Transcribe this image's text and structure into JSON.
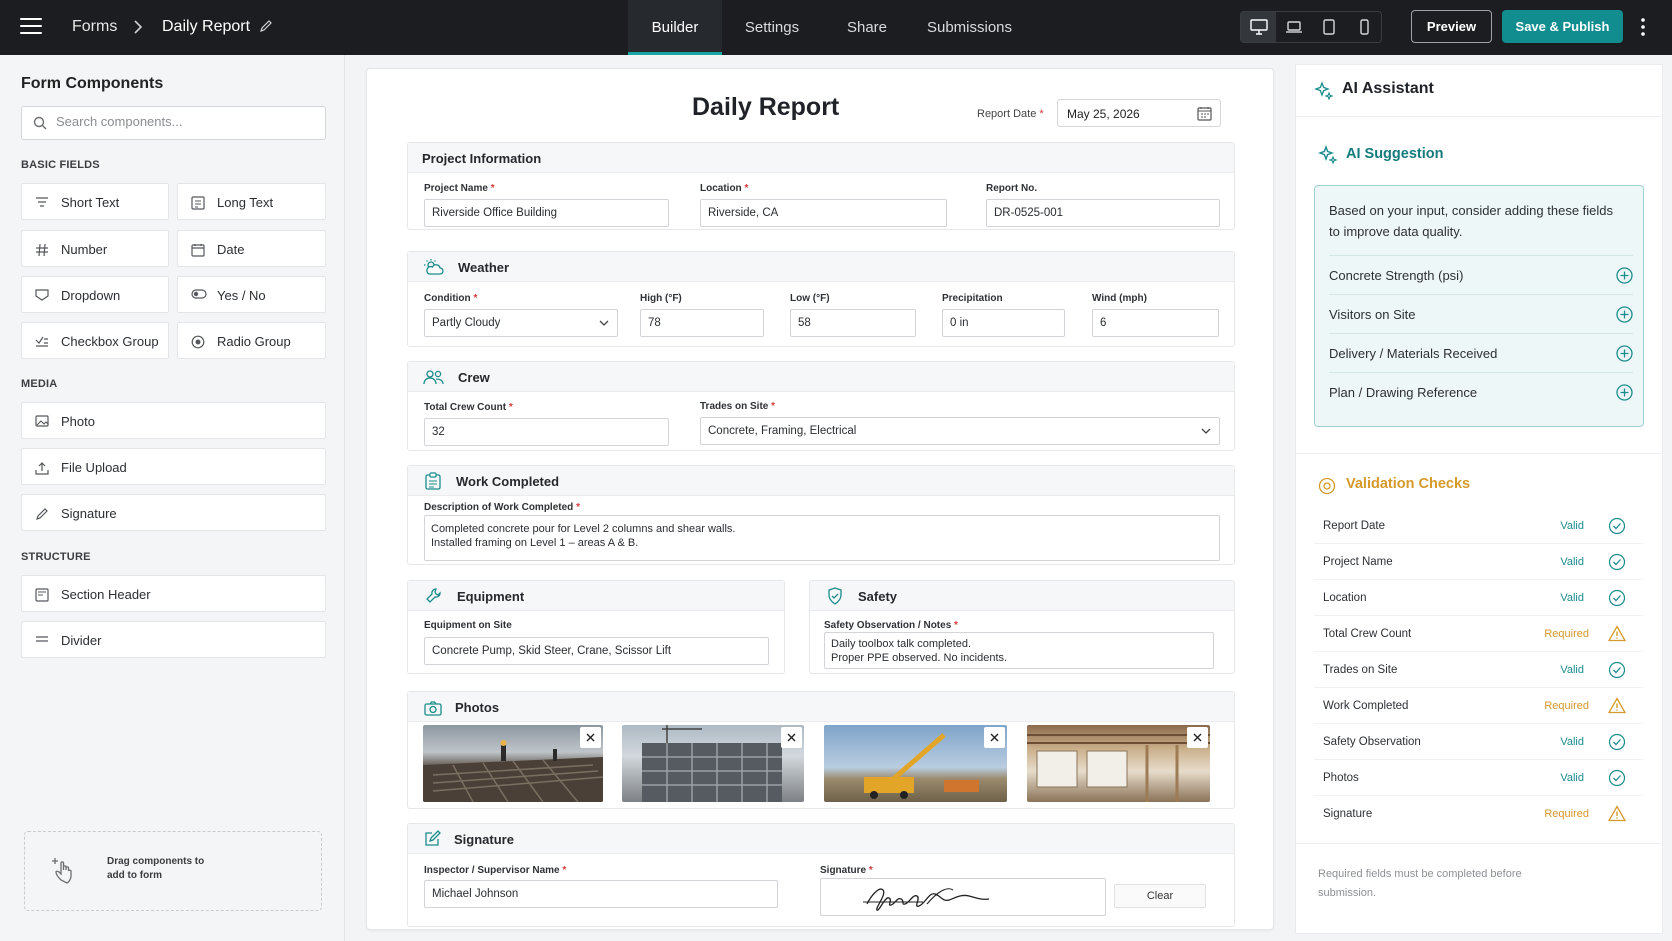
{
  "topbar": {
    "breadcrumb_root": "Forms",
    "breadcrumb_current": "Daily Report",
    "tabs": [
      {
        "label": "Builder",
        "active": true
      },
      {
        "label": "Settings",
        "active": false
      },
      {
        "label": "Share",
        "active": false
      },
      {
        "label": "Submissions",
        "active": false
      }
    ],
    "devices": [
      "desktop-icon",
      "laptop-icon",
      "tablet-icon",
      "mobile-icon"
    ],
    "preview_label": "Preview",
    "publish_label": "Save & Publish",
    "accent": "#128d8f"
  },
  "sidebar": {
    "title": "Form Components",
    "search_placeholder": "Search components...",
    "basic_label": "BASIC FIELDS",
    "basic": [
      {
        "label": "Short Text",
        "icon": "short-text-icon"
      },
      {
        "label": "Long Text",
        "icon": "long-text-icon"
      },
      {
        "label": "Number",
        "icon": "hash-icon"
      },
      {
        "label": "Date",
        "icon": "calendar-icon"
      },
      {
        "label": "Dropdown",
        "icon": "dropdown-icon"
      },
      {
        "label": "Yes / No",
        "icon": "toggle-icon"
      },
      {
        "label": "Checkbox Group",
        "icon": "checkbox-group-icon"
      },
      {
        "label": "Radio Group",
        "icon": "radio-icon"
      }
    ],
    "media_label": "MEDIA",
    "media": [
      {
        "label": "Photo",
        "icon": "image-icon"
      },
      {
        "label": "File Upload",
        "icon": "upload-icon"
      },
      {
        "label": "Signature",
        "icon": "pen-icon"
      }
    ],
    "structure_label": "STRUCTURE",
    "structure": [
      {
        "label": "Section Header",
        "icon": "section-header-icon"
      },
      {
        "label": "Divider",
        "icon": "divider-icon"
      }
    ],
    "dropzone_text": "Drag components to add to form"
  },
  "form": {
    "title": "Daily Report",
    "report_date_label": "Report Date",
    "report_date_value": "May 25, 2026",
    "project": {
      "title": "Project Information",
      "name_label": "Project Name",
      "name_value": "Riverside Office Building",
      "location_label": "Location",
      "location_value": "Riverside, CA",
      "report_no_label": "Report No.",
      "report_no_value": "DR-0525-001"
    },
    "weather": {
      "title": "Weather",
      "condition_label": "Condition",
      "condition_value": "Partly Cloudy",
      "high_label": "High (°F)",
      "high_value": "78",
      "low_label": "Low (°F)",
      "low_value": "58",
      "precip_label": "Precipitation",
      "precip_value": "0 in",
      "wind_label": "Wind (mph)",
      "wind_value": "6"
    },
    "crew": {
      "title": "Crew",
      "count_label": "Total Crew Count",
      "count_value": "32",
      "trades_label": "Trades on Site",
      "trades_value": "Concrete, Framing, Electrical"
    },
    "work": {
      "title": "Work Completed",
      "desc_label": "Description of Work Completed",
      "desc_line1": "Completed concrete pour for Level 2 columns and shear walls.",
      "desc_line2": "Installed framing on Level 1 – areas A & B."
    },
    "equipment": {
      "title": "Equipment",
      "label": "Equipment on Site",
      "value": "Concrete Pump, Skid Steer, Crane, Scissor Lift"
    },
    "safety": {
      "title": "Safety",
      "label": "Safety Observation / Notes",
      "line1": "Daily toolbox talk completed.",
      "line2": "Proper PPE observed. No incidents."
    },
    "photos": {
      "title": "Photos"
    },
    "signature": {
      "title": "Signature",
      "inspector_label": "Inspector / Supervisor Name",
      "inspector_value": "Michael Johnson",
      "signature_label": "Signature",
      "clear_label": "Clear"
    }
  },
  "assistant": {
    "title": "AI Assistant",
    "suggestion_title": "AI Suggestion",
    "suggestion_intro": "Based on your input, consider adding these fields to improve data quality.",
    "suggestions": [
      "Concrete Strength (psi)",
      "Visitors on Site",
      "Delivery / Materials Received",
      "Plan / Drawing Reference"
    ],
    "validation_title": "Validation Checks",
    "checks": [
      {
        "name": "Report Date",
        "status": "Valid"
      },
      {
        "name": "Project Name",
        "status": "Valid"
      },
      {
        "name": "Location",
        "status": "Valid"
      },
      {
        "name": "Total Crew Count",
        "status": "Required"
      },
      {
        "name": "Trades on Site",
        "status": "Valid"
      },
      {
        "name": "Work Completed",
        "status": "Required"
      },
      {
        "name": "Safety Observation",
        "status": "Valid"
      },
      {
        "name": "Photos",
        "status": "Valid"
      },
      {
        "name": "Signature",
        "status": "Required"
      }
    ],
    "footer_note": "Required fields must be completed before submission.",
    "valid_color": "#1b8c8c",
    "required_color": "#d6962a"
  }
}
